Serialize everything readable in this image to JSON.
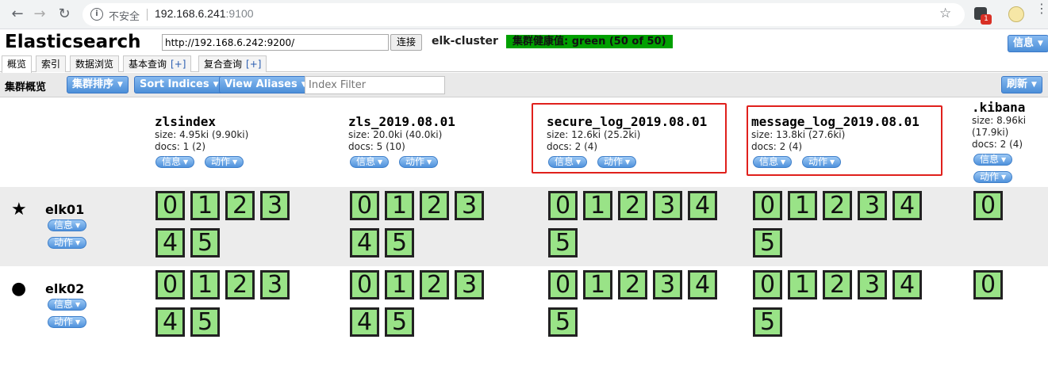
{
  "browser": {
    "insecure_label": "不安全",
    "url_host": "192.168.6.241",
    "url_port": ":9100",
    "badge": "1"
  },
  "app": {
    "title": "Elasticsearch",
    "connect_url": "http://192.168.6.242:9200/",
    "connect_label": "连接",
    "cluster_name": "elk-cluster",
    "health": "集群健康值: green (50 of 50)",
    "info_label": "信息"
  },
  "tabs": [
    {
      "label": "概览",
      "active": true
    },
    {
      "label": "索引"
    },
    {
      "label": "数据浏览"
    },
    {
      "label": "基本查询",
      "plus": "[+]"
    },
    {
      "label": "复合查询",
      "plus": "[+]"
    }
  ],
  "toolbar": {
    "label": "集群概览",
    "sort_cluster": "集群排序",
    "sort_indices": "Sort Indices",
    "view_aliases": "View Aliases",
    "filter_placeholder": "Index Filter",
    "refresh": "刷新"
  },
  "pill_labels": {
    "info": "信息",
    "action": "动作"
  },
  "indices": [
    {
      "name": "zlsindex",
      "size": "size: 4.95ki (9.90ki)",
      "docs": "docs: 1 (2)"
    },
    {
      "name": "zls_2019.08.01",
      "size": "size: 20.0ki (40.0ki)",
      "docs": "docs: 5 (10)"
    },
    {
      "name": "secure_log_2019.08.01",
      "size": "size: 12.6ki (25.2ki)",
      "docs": "docs: 2 (4)"
    },
    {
      "name": "message_log_2019.08.01",
      "size": "size: 13.8ki (27.6ki)",
      "docs": "docs: 2 (4)"
    },
    {
      "name": ".kibana",
      "size": "size: 8.96ki",
      "size2": "(17.9ki)",
      "docs": "docs: 2 (4)"
    }
  ],
  "nodes": [
    {
      "name": "elk01",
      "icon": "★",
      "master": true
    },
    {
      "name": "elk02",
      "icon": "●",
      "master": false
    }
  ],
  "shards": [
    "0",
    "1",
    "2",
    "3",
    "4",
    "5"
  ]
}
